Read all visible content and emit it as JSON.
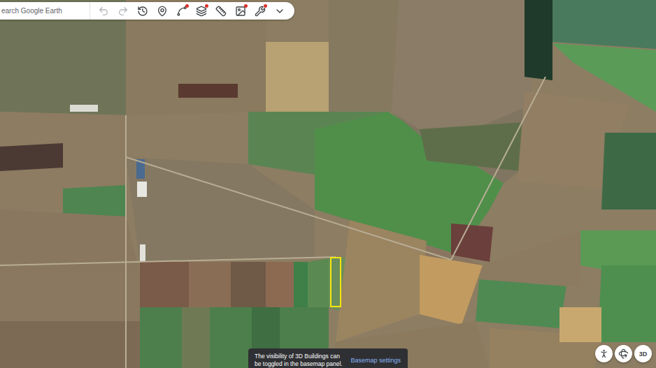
{
  "search": {
    "placeholder": "earch Google Earth"
  },
  "toolbar": [
    {
      "kind": "undo",
      "disabled": true,
      "badge": false
    },
    {
      "kind": "redo",
      "disabled": true,
      "badge": false
    },
    {
      "kind": "history",
      "disabled": false,
      "badge": false
    },
    {
      "kind": "placemark",
      "disabled": false,
      "badge": false
    },
    {
      "kind": "path",
      "disabled": false,
      "badge": true
    },
    {
      "kind": "layers",
      "disabled": false,
      "badge": true
    },
    {
      "kind": "measure",
      "disabled": false,
      "badge": false
    },
    {
      "kind": "overlay",
      "disabled": false,
      "badge": true
    },
    {
      "kind": "tools",
      "disabled": false,
      "badge": true
    },
    {
      "kind": "more",
      "disabled": false,
      "badge": false
    }
  ],
  "toast": {
    "lines": [
      "The visibility of 3D Buildings can",
      "be toggled in the basemap panel."
    ],
    "action": "Basemap settings"
  },
  "map_controls": {
    "toggle_3d": "3D"
  }
}
